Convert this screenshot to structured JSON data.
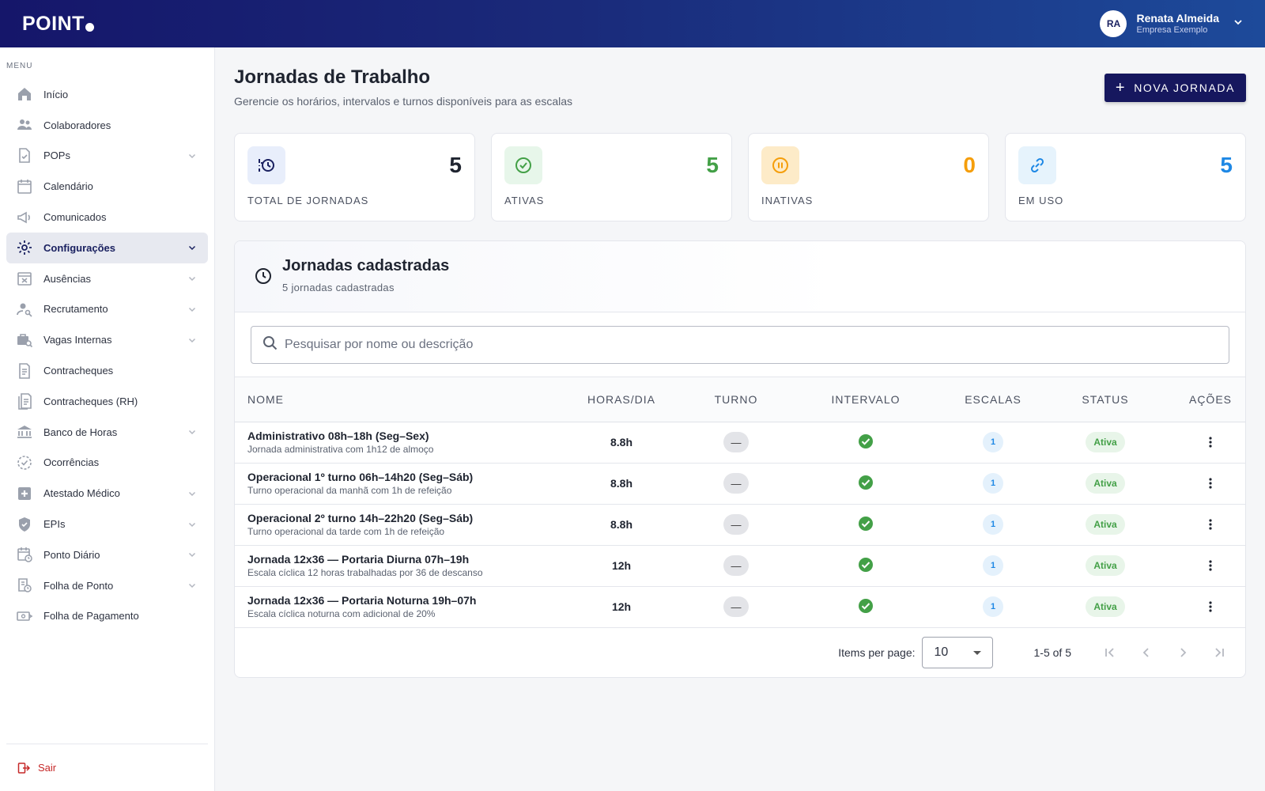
{
  "header": {
    "logo_text": "POINT",
    "user": {
      "initials": "RA",
      "name": "Renata Almeida",
      "company": "Empresa Exemplo"
    }
  },
  "sidebar": {
    "menu_label": "MENU",
    "items": [
      {
        "label": "Início",
        "icon": "home-icon",
        "chevron": false
      },
      {
        "label": "Colaboradores",
        "icon": "people-icon",
        "chevron": false
      },
      {
        "label": "POPs",
        "icon": "document-check-icon",
        "chevron": true
      },
      {
        "label": "Calendário",
        "icon": "calendar-icon",
        "chevron": false
      },
      {
        "label": "Comunicados",
        "icon": "megaphone-icon",
        "chevron": false
      },
      {
        "label": "Configurações",
        "icon": "gear-icon",
        "chevron": true,
        "active": true
      },
      {
        "label": "Ausências",
        "icon": "calendar-x-icon",
        "chevron": true
      },
      {
        "label": "Recrutamento",
        "icon": "person-search-icon",
        "chevron": true
      },
      {
        "label": "Vagas Internas",
        "icon": "briefcase-search-icon",
        "chevron": true
      },
      {
        "label": "Contracheques",
        "icon": "receipt-icon",
        "chevron": false
      },
      {
        "label": "Contracheques (RH)",
        "icon": "receipt-multi-icon",
        "chevron": false
      },
      {
        "label": "Banco de Horas",
        "icon": "bank-icon",
        "chevron": true
      },
      {
        "label": "Ocorrências",
        "icon": "check-circle-dashed-icon",
        "chevron": false
      },
      {
        "label": "Atestado Médico",
        "icon": "medical-plus-icon",
        "chevron": true
      },
      {
        "label": "EPIs",
        "icon": "shield-icon",
        "chevron": true
      },
      {
        "label": "Ponto Diário",
        "icon": "calendar-clock-icon",
        "chevron": true
      },
      {
        "label": "Folha de Ponto",
        "icon": "sheet-clock-icon",
        "chevron": true
      },
      {
        "label": "Folha de Pagamento",
        "icon": "payment-icon",
        "chevron": false
      }
    ],
    "logout_label": "Sair"
  },
  "page": {
    "title": "Jornadas de Trabalho",
    "subtitle": "Gerencie os horários, intervalos e turnos disponíveis para as escalas",
    "new_button": "NOVA JORNADA"
  },
  "stats": [
    {
      "label": "TOTAL DE JORNADAS",
      "value": "5",
      "color": "#1f2430",
      "icon": "clock-history-icon",
      "icon_bg": "#e8eefb"
    },
    {
      "label": "ATIVAS",
      "value": "5",
      "color": "#43a047",
      "icon": "check-circle-icon",
      "icon_bg": "#e7f6ea"
    },
    {
      "label": "INATIVAS",
      "value": "0",
      "color": "#f59e0b",
      "icon": "pause-circle-icon",
      "icon_bg": "#fdebc8"
    },
    {
      "label": "EM USO",
      "value": "5",
      "color": "#1e88e5",
      "icon": "link-icon",
      "icon_bg": "#e6f3fc"
    }
  ],
  "card": {
    "title": "Jornadas cadastradas",
    "subtitle": "5 jornadas cadastradas",
    "search_placeholder": "Pesquisar por nome ou descrição"
  },
  "table": {
    "columns": [
      "NOME",
      "HORAS/DIA",
      "TURNO",
      "INTERVALO",
      "ESCALAS",
      "STATUS",
      "AÇÕES"
    ],
    "rows": [
      {
        "name": "Administrativo 08h–18h (Seg–Sex)",
        "desc": "Jornada administrativa com 1h12 de almoço",
        "hours": "8.8h",
        "turno": "—",
        "escalas": "1",
        "status": "Ativa"
      },
      {
        "name": "Operacional 1º turno 06h–14h20 (Seg–Sáb)",
        "desc": "Turno operacional da manhã com 1h de refeição",
        "hours": "8.8h",
        "turno": "—",
        "escalas": "1",
        "status": "Ativa"
      },
      {
        "name": "Operacional 2º turno 14h–22h20 (Seg–Sáb)",
        "desc": "Turno operacional da tarde com 1h de refeição",
        "hours": "8.8h",
        "turno": "—",
        "escalas": "1",
        "status": "Ativa"
      },
      {
        "name": "Jornada 12x36 — Portaria Diurna 07h–19h",
        "desc": "Escala cíclica 12 horas trabalhadas por 36 de descanso",
        "hours": "12h",
        "turno": "—",
        "escalas": "1",
        "status": "Ativa"
      },
      {
        "name": "Jornada 12x36 — Portaria Noturna 19h–07h",
        "desc": "Escala cíclica noturna com adicional de 20%",
        "hours": "12h",
        "turno": "—",
        "escalas": "1",
        "status": "Ativa"
      }
    ]
  },
  "paginator": {
    "items_per_page_label": "Items per page:",
    "per_page": "10",
    "range": "1-5 of 5"
  }
}
